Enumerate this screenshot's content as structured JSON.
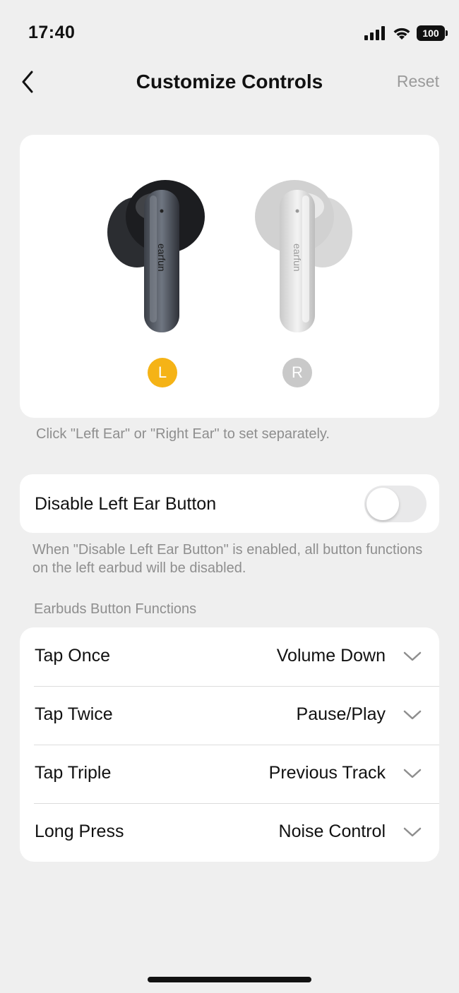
{
  "status_bar": {
    "time": "17:40",
    "battery": "100",
    "icons": [
      "signal-icon",
      "wifi-icon",
      "battery-icon"
    ]
  },
  "nav": {
    "title": "Customize Controls",
    "reset_label": "Reset",
    "back_icon": "chevron-left-icon"
  },
  "earbuds": {
    "left_badge": "L",
    "right_badge": "R",
    "brand_text": "earfun",
    "selected": "L",
    "colors": {
      "selected": "#f5b316",
      "unselected": "#c9c9c9"
    }
  },
  "hint": "Click \"Left Ear\" or \"Right Ear\" to set separately.",
  "disable": {
    "label": "Disable Left Ear Button",
    "enabled": false,
    "description": "When \"Disable Left Ear Button\" is enabled, all button functions on the left earbud will be disabled."
  },
  "functions": {
    "section_title": "Earbuds Button Functions",
    "rows": [
      {
        "label": "Tap Once",
        "value": "Volume Down"
      },
      {
        "label": "Tap Twice",
        "value": "Pause/Play"
      },
      {
        "label": "Tap Triple",
        "value": "Previous Track"
      },
      {
        "label": "Long Press",
        "value": "Noise Control"
      }
    ]
  }
}
